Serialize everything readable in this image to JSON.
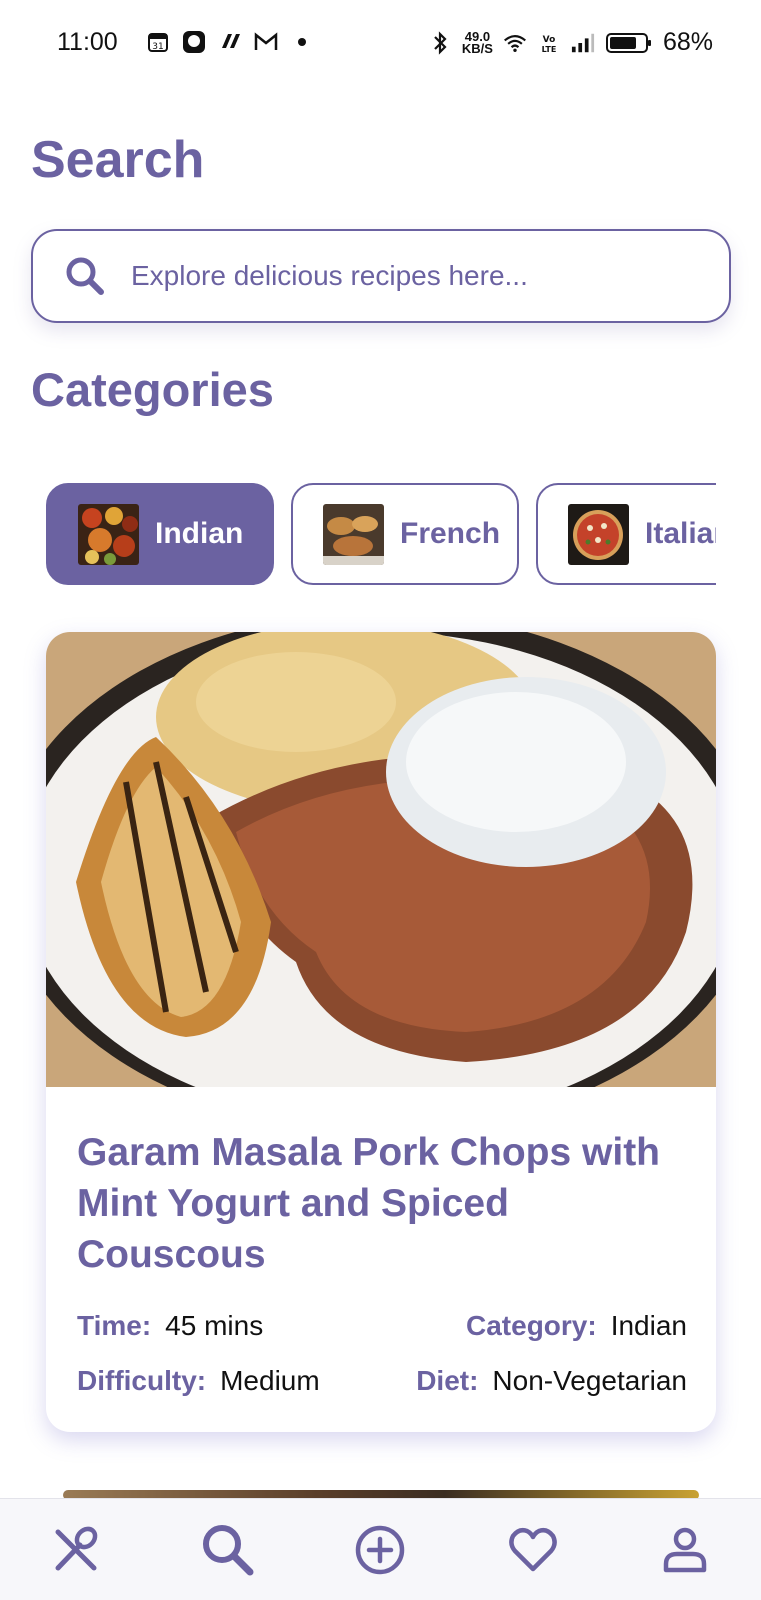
{
  "status_bar": {
    "time": "11:00",
    "net_speed": "49.0",
    "net_unit": "KB/S",
    "battery": "68%"
  },
  "page": {
    "title": "Search"
  },
  "search": {
    "placeholder": "Explore delicious recipes here..."
  },
  "categories": {
    "title": "Categories",
    "items": [
      {
        "label": "Indian",
        "active": true
      },
      {
        "label": "French",
        "active": false
      },
      {
        "label": "Italian",
        "active": false
      }
    ]
  },
  "recipe_card": {
    "title": "Garam Masala Pork Chops with Mint Yogurt and Spiced Couscous",
    "time_label": "Time:",
    "time_value": "45 mins",
    "category_label": "Category:",
    "category_value": "Indian",
    "difficulty_label": "Difficulty:",
    "difficulty_value": "Medium",
    "diet_label": "Diet:",
    "diet_value": "Non-Vegetarian"
  },
  "bottom_nav": {
    "items": [
      {
        "icon": "fork-spoon-icon"
      },
      {
        "icon": "search-icon"
      },
      {
        "icon": "add-circle-icon"
      },
      {
        "icon": "heart-icon"
      },
      {
        "icon": "profile-icon"
      }
    ]
  },
  "colors": {
    "accent": "#6b62a1",
    "text": "#111111"
  }
}
